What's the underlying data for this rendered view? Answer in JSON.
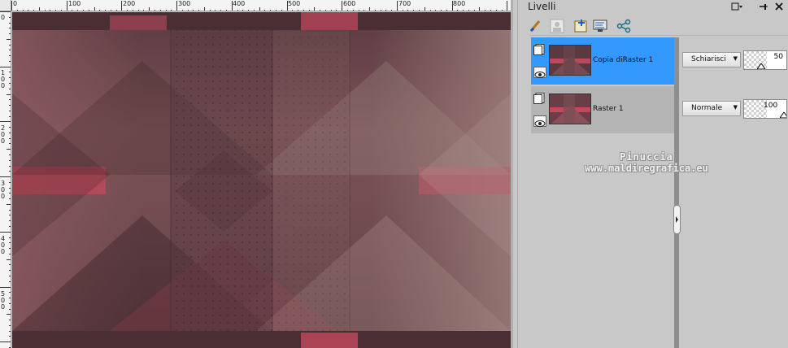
{
  "ruler": {
    "top_labels": [
      "0",
      "100",
      "200",
      "300",
      "400",
      "500",
      "600",
      "700",
      "800"
    ],
    "left_labels": [
      "0",
      "1\n0\n0",
      "2\n0\n0",
      "3\n0\n0",
      "4\n0\n0",
      "5\n0\n0"
    ]
  },
  "panel": {
    "title": "Livelli",
    "window_buttons": {
      "menu": "▢ ▾",
      "pin": "⊣",
      "close": "✕"
    }
  },
  "layers": [
    {
      "name": "Copia diRaster 1",
      "selected": true,
      "blend_mode": "Schiarisci",
      "opacity": "50",
      "opacity_fraction": 0.5
    },
    {
      "name": "Raster 1",
      "selected": false,
      "blend_mode": "Normale",
      "opacity": "100",
      "opacity_fraction": 1.0
    }
  ],
  "watermark": {
    "line1": "Pinuccia",
    "line2": "www.maldiregrafica.eu"
  },
  "colors": {
    "selection": "#3399ff",
    "image_base": "#6a4a4e",
    "accent_red": "#c4485c"
  },
  "icons": [
    "brush-icon",
    "mask-icon",
    "new-layer-icon",
    "layer-properties-icon",
    "share-icon",
    "paper-icon",
    "eye-icon"
  ]
}
